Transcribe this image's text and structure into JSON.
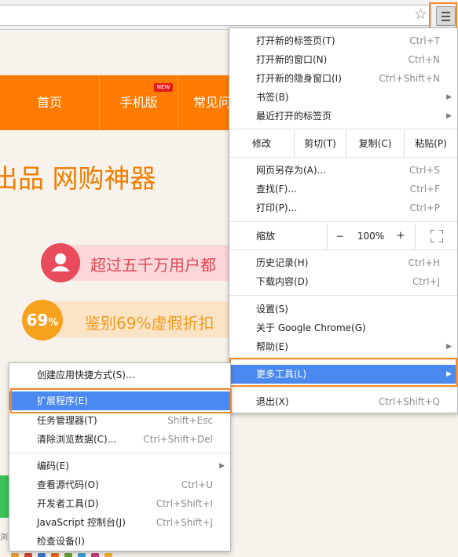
{
  "browser": {
    "star_icon": "star-icon",
    "menu_icon": "hamburger-icon"
  },
  "page": {
    "nav": [
      "首页",
      "手机版",
      "常见问"
    ],
    "nav_badge": "NEW",
    "hero": "出品 网购神器",
    "feature1": "超过五千万用户都",
    "feature2_badge_num": "69",
    "feature2_badge_pct": "%",
    "feature2": "鉴别69%虚假折扣",
    "small": "浏"
  },
  "menu": {
    "items_top": [
      {
        "label": "打开新的标签页(T)",
        "shortcut": "Ctrl+T"
      },
      {
        "label": "打开新的窗口(N)",
        "shortcut": "Ctrl+N"
      },
      {
        "label": "打开新的隐身窗口(I)",
        "shortcut": "Ctrl+Shift+N"
      },
      {
        "label": "书签(B)",
        "shortcut": ""
      },
      {
        "label": "最近打开的标签页",
        "shortcut": ""
      }
    ],
    "edit": {
      "label": "修改",
      "cut": "剪切(T)",
      "copy": "复制(C)",
      "paste": "粘贴(P)"
    },
    "items_page": [
      {
        "label": "网页另存为(A)...",
        "shortcut": "Ctrl+S"
      },
      {
        "label": "查找(F)...",
        "shortcut": "Ctrl+F"
      },
      {
        "label": "打印(P)...",
        "shortcut": "Ctrl+P"
      }
    ],
    "zoom": {
      "label": "缩放",
      "minus": "−",
      "value": "100%",
      "plus": "+"
    },
    "items_history": [
      {
        "label": "历史记录(H)",
        "shortcut": "Ctrl+H"
      },
      {
        "label": "下载内容(D)",
        "shortcut": "Ctrl+J"
      }
    ],
    "items_settings": [
      {
        "label": "设置(S)"
      },
      {
        "label": "关于 Google Chrome(G)"
      },
      {
        "label": "帮助(E)"
      }
    ],
    "more_tools": "更多工具(L)",
    "exit": {
      "label": "退出(X)",
      "shortcut": "Ctrl+Shift+Q"
    }
  },
  "submenu": {
    "shortcut_app": "创建应用快捷方式(S)...",
    "items": [
      {
        "label": "扩展程序(E)",
        "shortcut": ""
      },
      {
        "label": "任务管理器(T)",
        "shortcut": "Shift+Esc"
      },
      {
        "label": "清除浏览数据(C)...",
        "shortcut": "Ctrl+Shift+Del"
      }
    ],
    "dev": [
      {
        "label": "编码(E)",
        "shortcut": ""
      },
      {
        "label": "查看源代码(O)",
        "shortcut": "Ctrl+U"
      },
      {
        "label": "开发者工具(D)",
        "shortcut": "Ctrl+Shift+I"
      },
      {
        "label": "JavaScript 控制台(J)",
        "shortcut": "Ctrl+Shift+J"
      },
      {
        "label": "检查设备(I)",
        "shortcut": ""
      }
    ]
  },
  "colors": {
    "accent": "#f58a2a",
    "selected": "#4a89f0",
    "nav": "#ff7a00"
  }
}
